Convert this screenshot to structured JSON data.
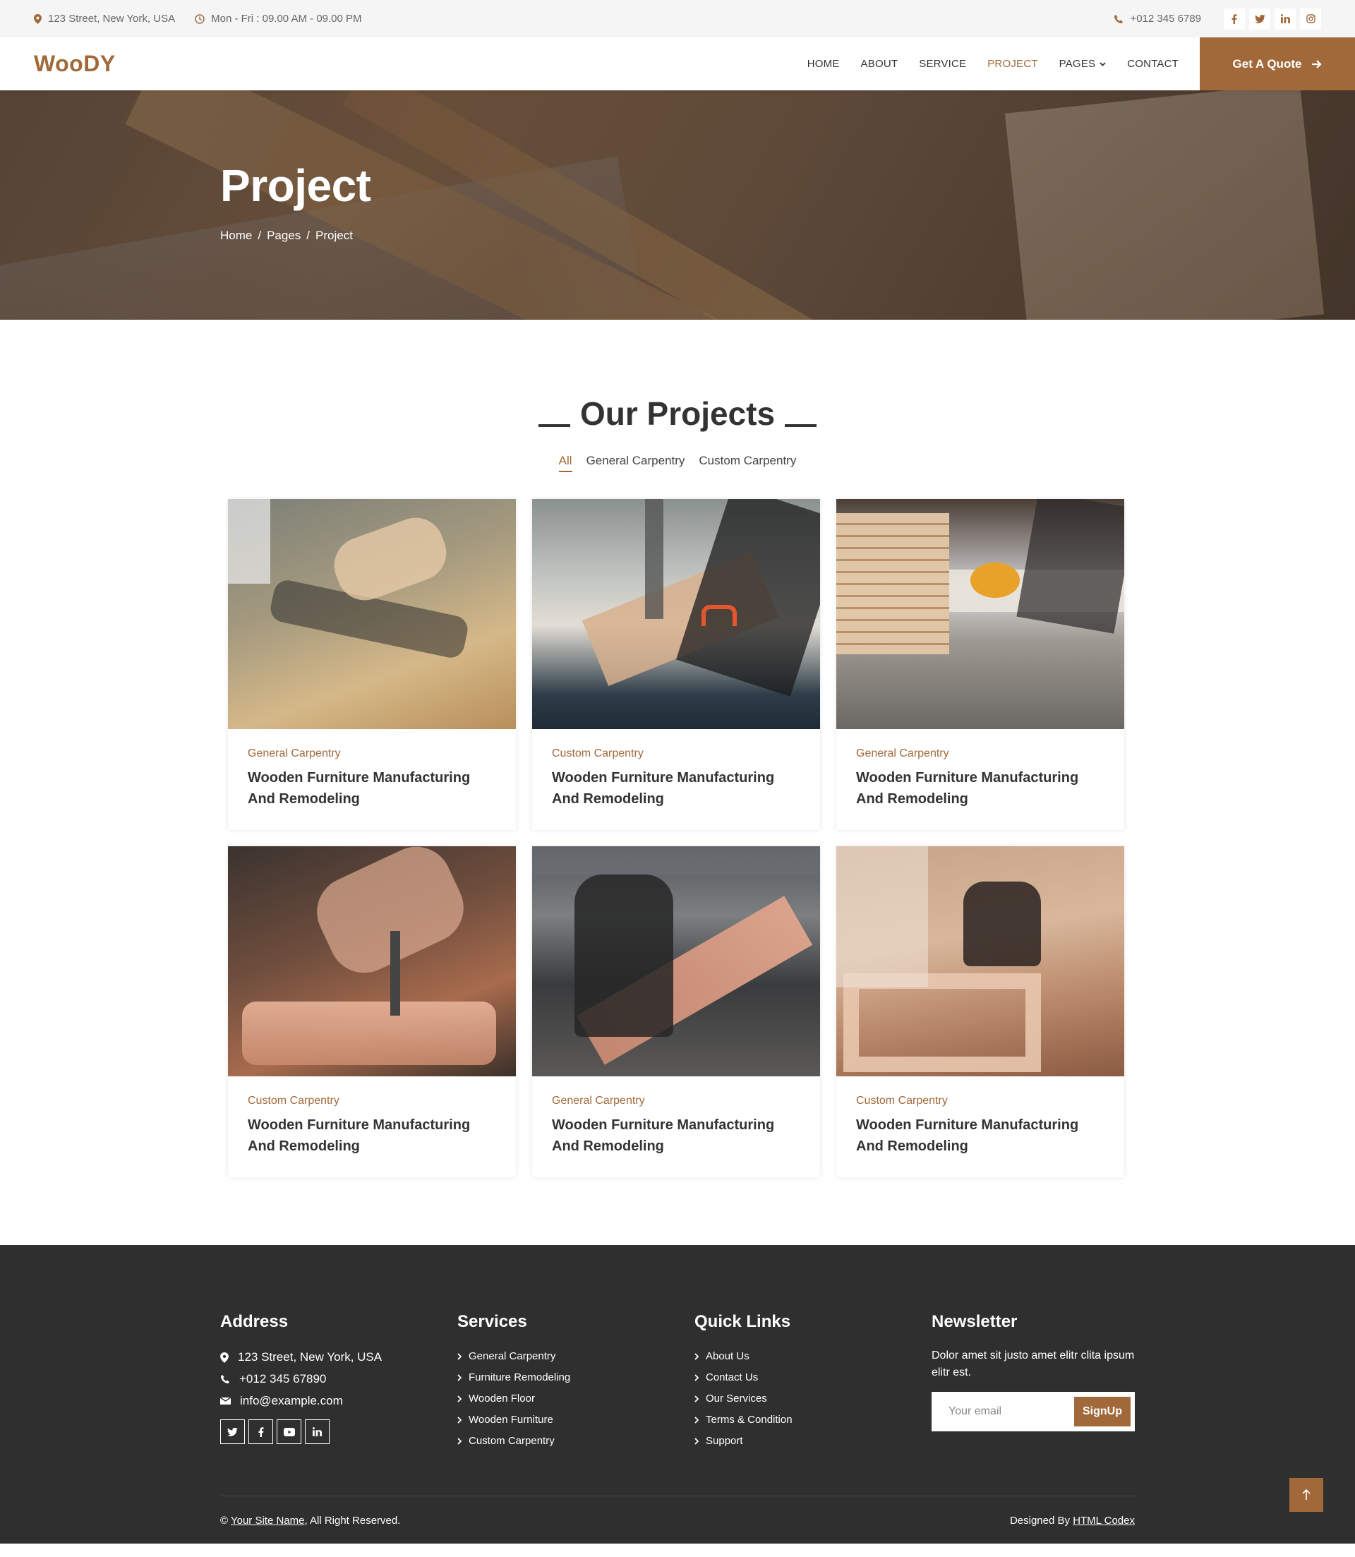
{
  "topbar": {
    "address": "123 Street, New York, USA",
    "hours": "Mon - Fri : 09.00 AM - 09.00 PM",
    "phone": "+012 345 6789",
    "social_icons": [
      "facebook-icon",
      "twitter-icon",
      "linkedin-icon",
      "instagram-icon"
    ]
  },
  "nav": {
    "brand": "WooDY",
    "items": [
      {
        "label": "HOME"
      },
      {
        "label": "ABOUT"
      },
      {
        "label": "SERVICE"
      },
      {
        "label": "PROJECT",
        "active": true
      },
      {
        "label": "PAGES",
        "dropdown": true
      },
      {
        "label": "CONTACT"
      }
    ],
    "cta": "Get A Quote"
  },
  "hero": {
    "title": "Project",
    "breadcrumb": [
      "Home",
      "Pages",
      "Project"
    ]
  },
  "projects": {
    "heading": "Our Projects",
    "filters": [
      {
        "label": "All",
        "active": true
      },
      {
        "label": "General Carpentry"
      },
      {
        "label": "Custom Carpentry"
      }
    ],
    "cards": [
      {
        "category": "General Carpentry",
        "title": "Wooden Furniture Manufacturing And Remodeling"
      },
      {
        "category": "Custom Carpentry",
        "title": "Wooden Furniture Manufacturing And Remodeling"
      },
      {
        "category": "General Carpentry",
        "title": "Wooden Furniture Manufacturing And Remodeling"
      },
      {
        "category": "Custom Carpentry",
        "title": "Wooden Furniture Manufacturing And Remodeling"
      },
      {
        "category": "General Carpentry",
        "title": "Wooden Furniture Manufacturing And Remodeling"
      },
      {
        "category": "Custom Carpentry",
        "title": "Wooden Furniture Manufacturing And Remodeling"
      }
    ]
  },
  "footer": {
    "address": {
      "heading": "Address",
      "street": "123 Street, New York, USA",
      "phone": "+012 345 67890",
      "email": "info@example.com",
      "social_icons": [
        "twitter-icon",
        "facebook-icon",
        "youtube-icon",
        "linkedin-icon"
      ]
    },
    "services": {
      "heading": "Services",
      "links": [
        "General Carpentry",
        "Furniture Remodeling",
        "Wooden Floor",
        "Wooden Furniture",
        "Custom Carpentry"
      ]
    },
    "quick_links": {
      "heading": "Quick Links",
      "links": [
        "About Us",
        "Contact Us",
        "Our Services",
        "Terms & Condition",
        "Support"
      ]
    },
    "newsletter": {
      "heading": "Newsletter",
      "text": "Dolor amet sit justo amet elitr clita ipsum elitr est.",
      "placeholder": "Your email",
      "button": "SignUp"
    },
    "copyright_prefix": "©",
    "site_name": "Your Site Name",
    "copyright_suffix": ", All Right Reserved.",
    "designed_by": "Designed By",
    "designer": "HTML Codex"
  },
  "colors": {
    "accent": "#a1693a",
    "footer_bg": "#2f2f2f",
    "topbar_bg": "#f5f5f5"
  }
}
